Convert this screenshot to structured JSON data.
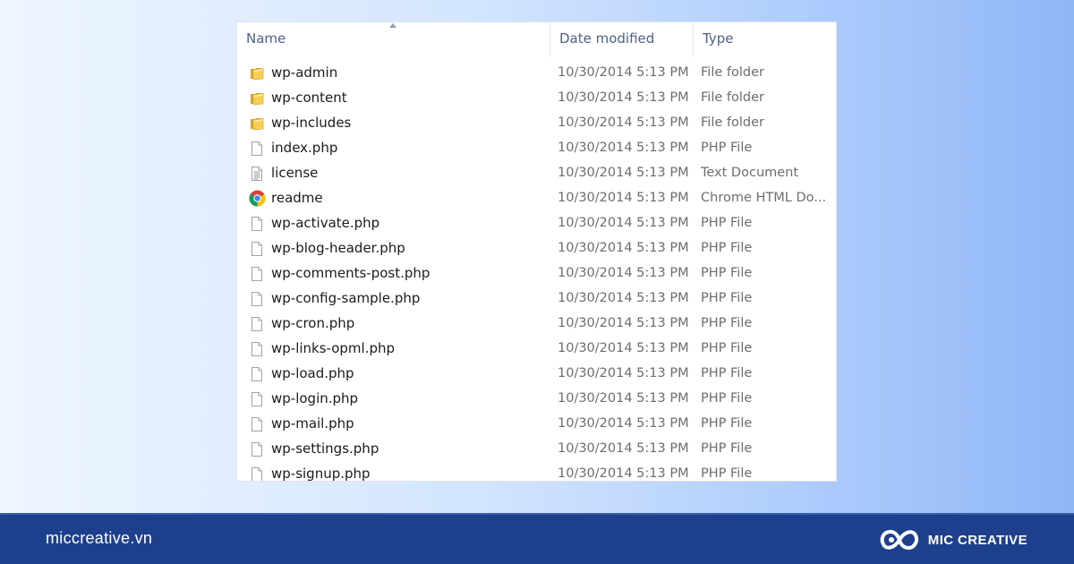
{
  "explorer": {
    "columns": {
      "name": "Name",
      "date": "Date modified",
      "type": "Type"
    },
    "files": [
      {
        "name": "wp-admin",
        "date": "10/30/2014 5:13 PM",
        "type": "File folder",
        "icon": "folder-icon"
      },
      {
        "name": "wp-content",
        "date": "10/30/2014 5:13 PM",
        "type": "File folder",
        "icon": "folder-icon"
      },
      {
        "name": "wp-includes",
        "date": "10/30/2014 5:13 PM",
        "type": "File folder",
        "icon": "folder-icon"
      },
      {
        "name": "index.php",
        "date": "10/30/2014 5:13 PM",
        "type": "PHP File",
        "icon": "file-icon"
      },
      {
        "name": "license",
        "date": "10/30/2014 5:13 PM",
        "type": "Text Document",
        "icon": "text-document-icon"
      },
      {
        "name": "readme",
        "date": "10/30/2014 5:13 PM",
        "type": "Chrome HTML Do...",
        "icon": "chrome-icon"
      },
      {
        "name": "wp-activate.php",
        "date": "10/30/2014 5:13 PM",
        "type": "PHP File",
        "icon": "file-icon"
      },
      {
        "name": "wp-blog-header.php",
        "date": "10/30/2014 5:13 PM",
        "type": "PHP File",
        "icon": "file-icon"
      },
      {
        "name": "wp-comments-post.php",
        "date": "10/30/2014 5:13 PM",
        "type": "PHP File",
        "icon": "file-icon"
      },
      {
        "name": "wp-config-sample.php",
        "date": "10/30/2014 5:13 PM",
        "type": "PHP File",
        "icon": "file-icon"
      },
      {
        "name": "wp-cron.php",
        "date": "10/30/2014 5:13 PM",
        "type": "PHP File",
        "icon": "file-icon"
      },
      {
        "name": "wp-links-opml.php",
        "date": "10/30/2014 5:13 PM",
        "type": "PHP File",
        "icon": "file-icon"
      },
      {
        "name": "wp-load.php",
        "date": "10/30/2014 5:13 PM",
        "type": "PHP File",
        "icon": "file-icon"
      },
      {
        "name": "wp-login.php",
        "date": "10/30/2014 5:13 PM",
        "type": "PHP File",
        "icon": "file-icon"
      },
      {
        "name": "wp-mail.php",
        "date": "10/30/2014 5:13 PM",
        "type": "PHP File",
        "icon": "file-icon"
      },
      {
        "name": "wp-settings.php",
        "date": "10/30/2014 5:13 PM",
        "type": "PHP File",
        "icon": "file-icon"
      },
      {
        "name": "wp-signup.php",
        "date": "10/30/2014 5:13 PM",
        "type": "PHP File",
        "icon": "file-icon"
      }
    ]
  },
  "footer": {
    "site": "miccreative.vn",
    "brand": "MIC CREATIVE",
    "background": "#1e3f8c"
  }
}
